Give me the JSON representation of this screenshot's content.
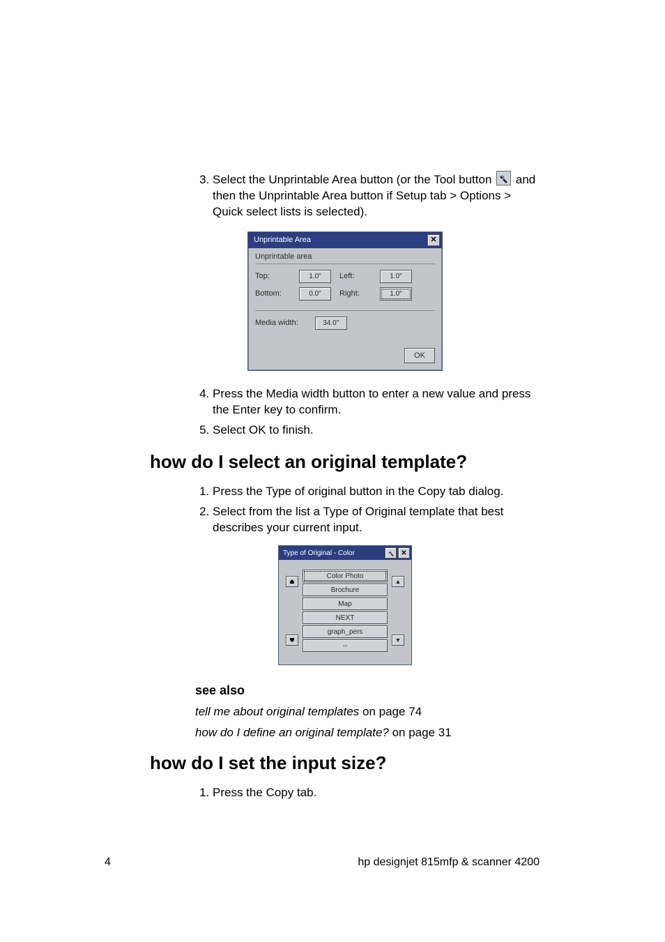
{
  "page_number": "4",
  "footer_text": "hp designjet 815mfp & scanner 4200",
  "step3": {
    "pre": "Select the Unprintable Area button (or the Tool button ",
    "post": " and then the Unprintable Area button if Setup tab > Options > Quick select lists is selected)."
  },
  "dialog1": {
    "title": "Unprintable Area",
    "group": "Unprintable area",
    "top_label": "Top:",
    "top_value": "1.0\"",
    "left_label": "Left:",
    "left_value": "1.0\"",
    "bottom_label": "Bottom:",
    "bottom_value": "0.0\"",
    "right_label": "Right:",
    "right_value": "1.0\"",
    "media_label": "Media width:",
    "media_value": "34.0\"",
    "ok": "OK"
  },
  "step4": "Press the Media width button to enter a new value and press the Enter key to confirm.",
  "step5": "Select OK to finish.",
  "heading1": "how do I select an original template?",
  "h1_step1": "Press the Type of original button in the Copy tab dialog.",
  "h1_step2": "Select from the list a Type of Original template that best describes your current input.",
  "dialog2": {
    "title": "Type of Original - Color",
    "items": [
      "Color Photo",
      "Brochure",
      "Map",
      "NEXT",
      "graph_pers",
      "--"
    ]
  },
  "seealso_heading": "see also",
  "seealso1_i": "tell me about original templates",
  "seealso1_r": " on page 74",
  "seealso2_i": "how do I define an original template?",
  "seealso2_r": " on page 31",
  "heading2": "how do I set the input size?",
  "h2_step1": "Press the Copy tab."
}
